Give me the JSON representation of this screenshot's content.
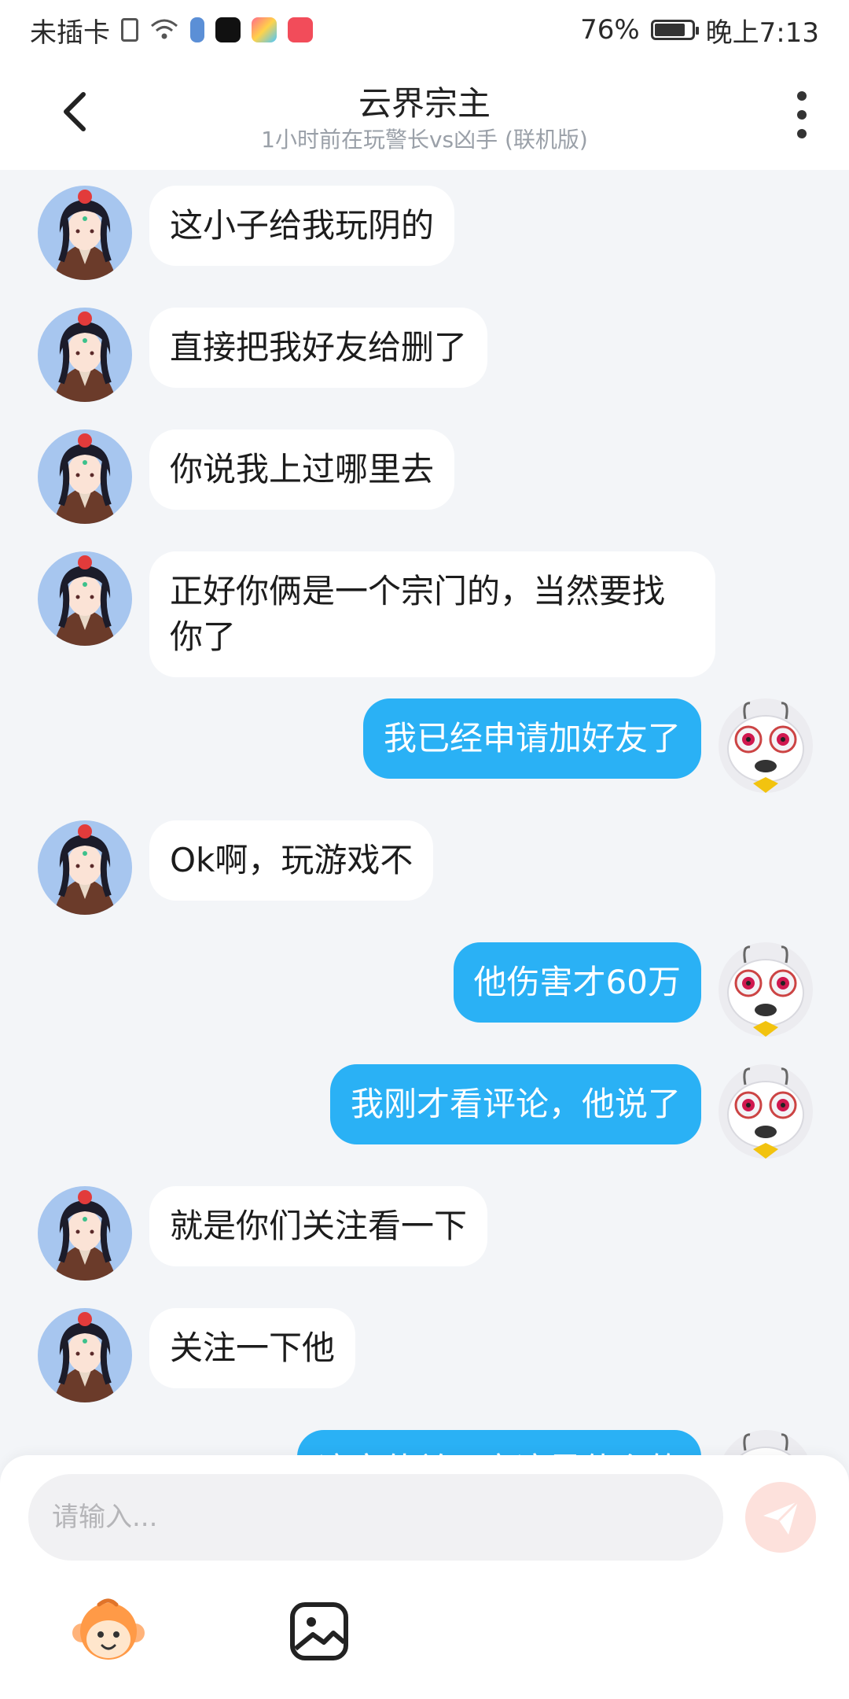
{
  "status_bar": {
    "carrier": "未插卡",
    "battery_percent": "76%",
    "time": "晚上7:13"
  },
  "header": {
    "title": "云界宗主",
    "subtitle": "1小时前在玩警长vs凶手 (联机版)"
  },
  "messages": [
    {
      "side": "in",
      "text": "这小子给我玩阴的"
    },
    {
      "side": "in",
      "text": "直接把我好友给删了"
    },
    {
      "side": "in",
      "text": "你说我上过哪里去"
    },
    {
      "side": "in",
      "text": "正好你俩是一个宗门的，当然要找你了"
    },
    {
      "side": "out",
      "text": "我已经申请加好友了"
    },
    {
      "side": "in",
      "text": "Ok啊，玩游戏不"
    },
    {
      "side": "out",
      "text": "他伤害才60万"
    },
    {
      "side": "out",
      "text": "我刚才看评论，他说了"
    },
    {
      "side": "in",
      "text": "就是你们关注看一下"
    },
    {
      "side": "in",
      "text": "关注一下他"
    },
    {
      "side": "out",
      "text": "这家伙关了它这是什么的"
    }
  ],
  "input": {
    "placeholder": "请输入..."
  },
  "icons": {
    "back": "chevron-left-icon",
    "more": "more-vertical-icon",
    "send": "paper-plane-icon",
    "emoji": "monkey-face-icon",
    "image": "image-icon"
  },
  "colors": {
    "outgoing_bubble": "#2ab1f5",
    "incoming_bubble": "#ffffff",
    "background": "#f3f5f8",
    "send_button": "#fde1dc"
  }
}
